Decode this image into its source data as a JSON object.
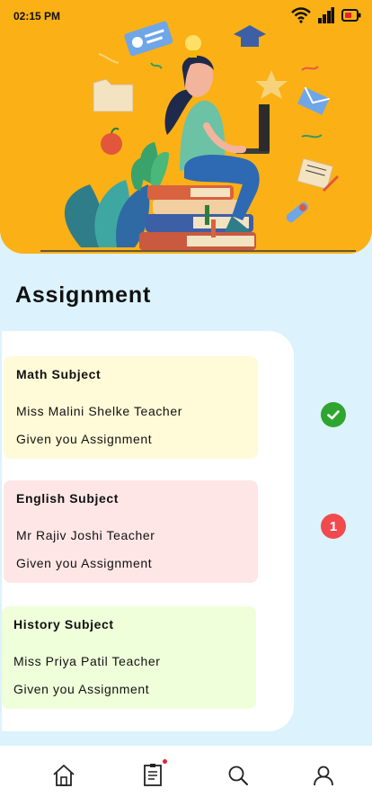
{
  "status_bar": {
    "time": "02:15 PM",
    "icons": [
      "wifi-icon",
      "signal-icon",
      "battery-icon"
    ]
  },
  "header": {
    "illustration": "student-studying-illustration",
    "background_color": "#fbb016"
  },
  "page": {
    "title": "Assignment"
  },
  "assignments": [
    {
      "subject": "Math Subject",
      "teacher": "Miss Malini Shelke Teacher",
      "note": "Given you Assignment",
      "status": "check-icon",
      "color": "#fffad8"
    },
    {
      "subject": "English Subject",
      "teacher": "Mr Rajiv Joshi Teacher",
      "note": "Given you Assignment",
      "status": "1",
      "color": "#ffe6e6"
    },
    {
      "subject": "History Subject",
      "teacher": "Miss Priya Patil Teacher",
      "note": "Given you Assignment",
      "status": "",
      "color": "#efffda"
    }
  ],
  "bottom_nav": {
    "items": [
      "home-icon",
      "assignment-icon",
      "search-icon",
      "profile-icon"
    ],
    "active_dot_color": "#e3232b"
  }
}
